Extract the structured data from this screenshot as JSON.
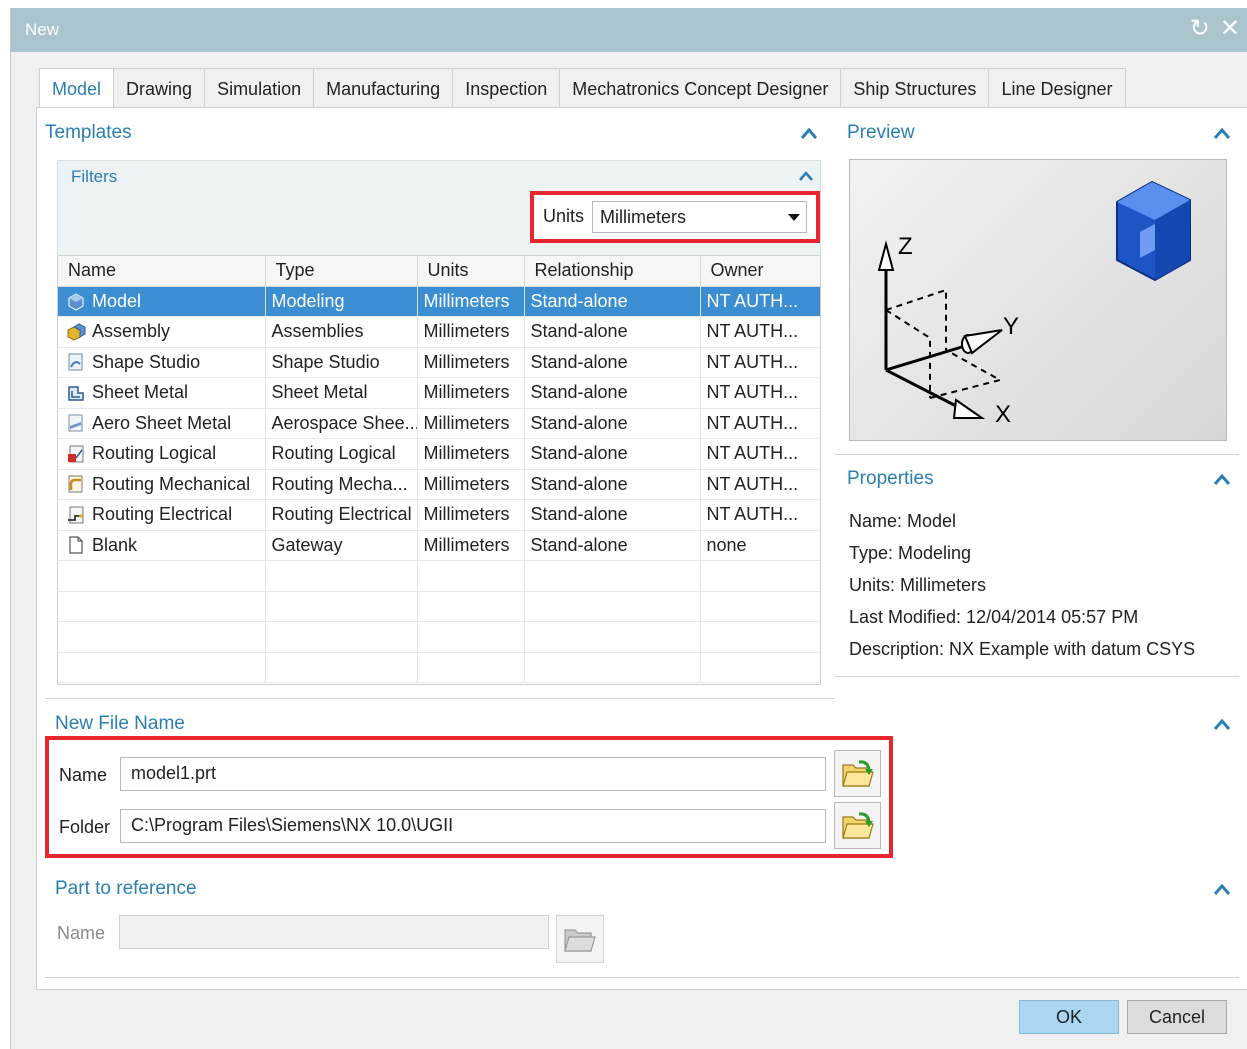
{
  "window": {
    "title": "New",
    "refresh_icon": "refresh-icon",
    "close_icon": "close-icon"
  },
  "tabs": [
    {
      "label": "Model",
      "active": true
    },
    {
      "label": "Drawing"
    },
    {
      "label": "Simulation"
    },
    {
      "label": "Manufacturing"
    },
    {
      "label": "Inspection"
    },
    {
      "label": "Mechatronics Concept Designer"
    },
    {
      "label": "Ship Structures"
    },
    {
      "label": "Line Designer"
    }
  ],
  "templates": {
    "title": "Templates",
    "filters": {
      "title": "Filters",
      "units_label": "Units",
      "units_value": "Millimeters"
    },
    "columns": [
      "Name",
      "Type",
      "Units",
      "Relationship",
      "Owner"
    ],
    "rows": [
      {
        "name": "Model",
        "type": "Modeling",
        "units": "Millimeters",
        "relationship": "Stand-alone",
        "owner": "NT AUTH...",
        "icon": "model-icon",
        "selected": true
      },
      {
        "name": "Assembly",
        "type": "Assemblies",
        "units": "Millimeters",
        "relationship": "Stand-alone",
        "owner": "NT AUTH...",
        "icon": "assembly-icon"
      },
      {
        "name": "Shape Studio",
        "type": "Shape Studio",
        "units": "Millimeters",
        "relationship": "Stand-alone",
        "owner": "NT AUTH...",
        "icon": "shape-studio-icon"
      },
      {
        "name": "Sheet Metal",
        "type": "Sheet Metal",
        "units": "Millimeters",
        "relationship": "Stand-alone",
        "owner": "NT AUTH...",
        "icon": "sheet-metal-icon"
      },
      {
        "name": "Aero Sheet Metal",
        "type": "Aerospace Shee...",
        "units": "Millimeters",
        "relationship": "Stand-alone",
        "owner": "NT AUTH...",
        "icon": "aero-sheet-metal-icon"
      },
      {
        "name": "Routing Logical",
        "type": "Routing Logical",
        "units": "Millimeters",
        "relationship": "Stand-alone",
        "owner": "NT AUTH...",
        "icon": "routing-logical-icon"
      },
      {
        "name": "Routing Mechanical",
        "type": "Routing Mecha...",
        "units": "Millimeters",
        "relationship": "Stand-alone",
        "owner": "NT AUTH...",
        "icon": "routing-mechanical-icon"
      },
      {
        "name": "Routing Electrical",
        "type": "Routing Electrical",
        "units": "Millimeters",
        "relationship": "Stand-alone",
        "owner": "NT AUTH...",
        "icon": "routing-electrical-icon"
      },
      {
        "name": "Blank",
        "type": "Gateway",
        "units": "Millimeters",
        "relationship": "Stand-alone",
        "owner": "none",
        "icon": "blank-icon"
      }
    ]
  },
  "preview": {
    "title": "Preview",
    "axis_z": "Z",
    "axis_y": "Y",
    "axis_x": "X"
  },
  "properties": {
    "title": "Properties",
    "name": "Name: Model",
    "type": "Type: Modeling",
    "units": "Units: Millimeters",
    "last_modified": "Last Modified: 12/04/2014 05:57 PM",
    "description": "Description: NX Example with datum CSYS"
  },
  "new_file_name": {
    "title": "New File Name",
    "name_label": "Name",
    "name_value": "model1.prt",
    "folder_label": "Folder",
    "folder_value": "C:\\Program Files\\Siemens\\NX 10.0\\UGII"
  },
  "part_to_reference": {
    "title": "Part to reference",
    "name_label": "Name",
    "name_value": ""
  },
  "buttons": {
    "ok": "OK",
    "cancel": "Cancel"
  },
  "colors": {
    "accent": "#2a7fb0",
    "title_bar": "#a9c4cd",
    "selection": "#3b8ed2",
    "highlight_box": "#e8262e",
    "ok_button": "#a9d6f0"
  }
}
